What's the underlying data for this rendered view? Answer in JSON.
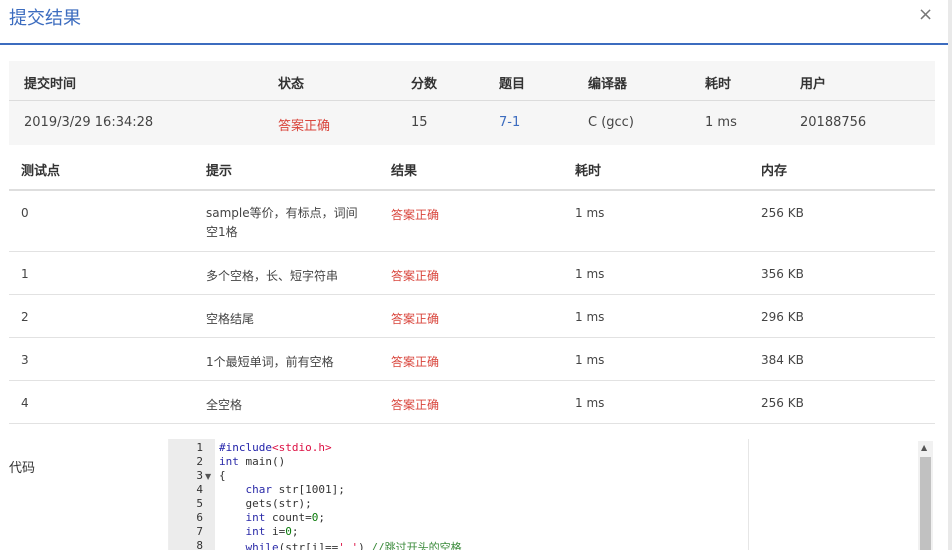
{
  "modal": {
    "title": "提交结果",
    "close_label": "×"
  },
  "summary": {
    "headers": [
      "提交时间",
      "状态",
      "分数",
      "题目",
      "编译器",
      "耗时",
      "用户"
    ],
    "values": [
      "2019/3/29 16:34:28",
      "答案正确",
      "15",
      "7-1",
      "C (gcc)",
      "1 ms",
      "20188756"
    ]
  },
  "testcases": {
    "headers": [
      "测试点",
      "提示",
      "结果",
      "耗时",
      "内存"
    ],
    "rows": [
      {
        "id": "0",
        "hint": "sample等价，有标点，词间空1格",
        "result": "答案正确",
        "time": "1 ms",
        "memory": "256 KB"
      },
      {
        "id": "1",
        "hint": "多个空格，长、短字符串",
        "result": "答案正确",
        "time": "1 ms",
        "memory": "356 KB"
      },
      {
        "id": "2",
        "hint": "空格结尾",
        "result": "答案正确",
        "time": "1 ms",
        "memory": "296 KB"
      },
      {
        "id": "3",
        "hint": "1个最短单词，前有空格",
        "result": "答案正确",
        "time": "1 ms",
        "memory": "384 KB"
      },
      {
        "id": "4",
        "hint": "全空格",
        "result": "答案正确",
        "time": "1 ms",
        "memory": "256 KB"
      }
    ]
  },
  "code": {
    "label": "代码",
    "line_numbers": [
      "1",
      "2",
      "3",
      "4",
      "5",
      "6",
      "7",
      "8"
    ],
    "lines": [
      "#include<stdio.h>",
      "int main()",
      "{",
      "    char str[1001];",
      "    gets(str);",
      "    int count=0;",
      "    int i=0;",
      "    while(str[i]==' ') //跳过开头的空格"
    ]
  },
  "colors": {
    "accent": "#3c6cbf",
    "accepted": "#d9453c"
  }
}
